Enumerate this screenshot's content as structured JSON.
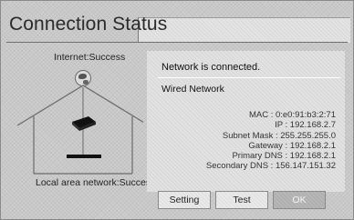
{
  "dialog": {
    "title": "Connection Status"
  },
  "diagram": {
    "internet_label": "Internet:Success",
    "lan_label": "Local area network:Success",
    "icons": [
      "globe-icon",
      "house-icon",
      "router-icon",
      "tv-icon"
    ]
  },
  "details": {
    "status_message": "Network is connected.",
    "network_type": "Wired Network",
    "rows": [
      "MAC : 0:e0:91:b3:2:71",
      "IP : 192.168.2.7",
      "Subnet Mask : 255.255.255.0",
      "Gateway : 192.168.2.1",
      "Primary DNS : 192.168.2.1",
      "Secondary DNS : 156.147.151.32"
    ]
  },
  "buttons": {
    "setting": "Setting",
    "test": "Test",
    "ok": "OK"
  }
}
